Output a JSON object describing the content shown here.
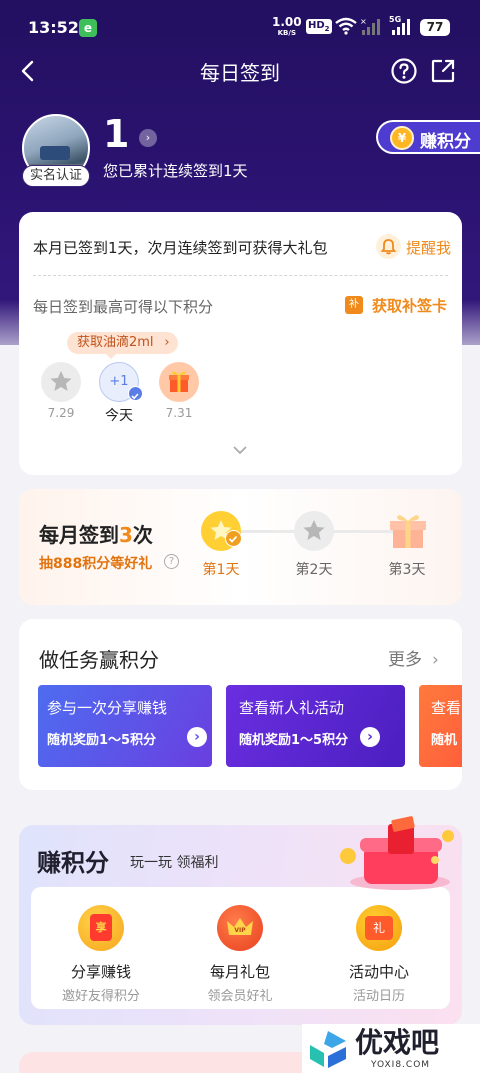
{
  "status_bar": {
    "time": "13:52",
    "app_badge": "e",
    "net_speed": "1.00",
    "net_unit": "KB/S",
    "hd": "HD",
    "hd_sub": "2",
    "five_g": "5G",
    "battery": "77"
  },
  "nav": {
    "title": "每日签到"
  },
  "profile": {
    "badge": "实名认证",
    "streak_count": "1",
    "streak_text": "您已累计连续签到1天",
    "earn_button": "赚积分",
    "earn_icon": "¥"
  },
  "checkin_card": {
    "month_text": "本月已签到1天，次月连续签到可获得大礼包",
    "remind_label": "提醒我",
    "points_text": "每日签到最高可得以下积分",
    "makeup_label": "获取补签卡",
    "makeup_icon": "补",
    "bubble": "获取油滴2ml",
    "days": [
      {
        "label": "7.29",
        "center": "",
        "state": "missed"
      },
      {
        "label": "今天",
        "center": "+1",
        "state": "today"
      },
      {
        "label": "7.31",
        "center": "",
        "state": "gift"
      }
    ]
  },
  "monthly": {
    "title_prefix": "每月签到",
    "title_count": "3",
    "title_suffix": "次",
    "subtitle": "抽888积分等好礼",
    "steps": [
      {
        "label": "第1天",
        "active": true
      },
      {
        "label": "第2天",
        "active": false
      },
      {
        "label": "第3天",
        "active": false
      }
    ]
  },
  "tasks": {
    "title": "做任务赢积分",
    "more": "更多",
    "items": [
      {
        "title": "参与一次分享赚钱",
        "reward": "随机奖励1～5积分",
        "color": "#4f5ce8"
      },
      {
        "title": "查看新人礼活动",
        "reward": "随机奖励1～5积分",
        "color": "#5a2ad0"
      },
      {
        "title": "查看",
        "reward": "随机",
        "color": "#ff6a3d"
      }
    ]
  },
  "earn": {
    "title": "赚积分",
    "subtitle": "玩一玩 领福利",
    "items": [
      {
        "label": "分享赚钱",
        "sub": "邀好友得积分",
        "glyph": "享"
      },
      {
        "label": "每月礼包",
        "sub": "领会员好礼",
        "glyph": "VIP"
      },
      {
        "label": "活动中心",
        "sub": "活动日历",
        "glyph": "礼"
      }
    ]
  },
  "watermark": {
    "text": "优戏吧",
    "url": "YOXI8.COM"
  },
  "colors": {
    "header": "#2b1372",
    "accent_orange": "#f08a1c",
    "blue_accent": "#5b7ce6"
  }
}
